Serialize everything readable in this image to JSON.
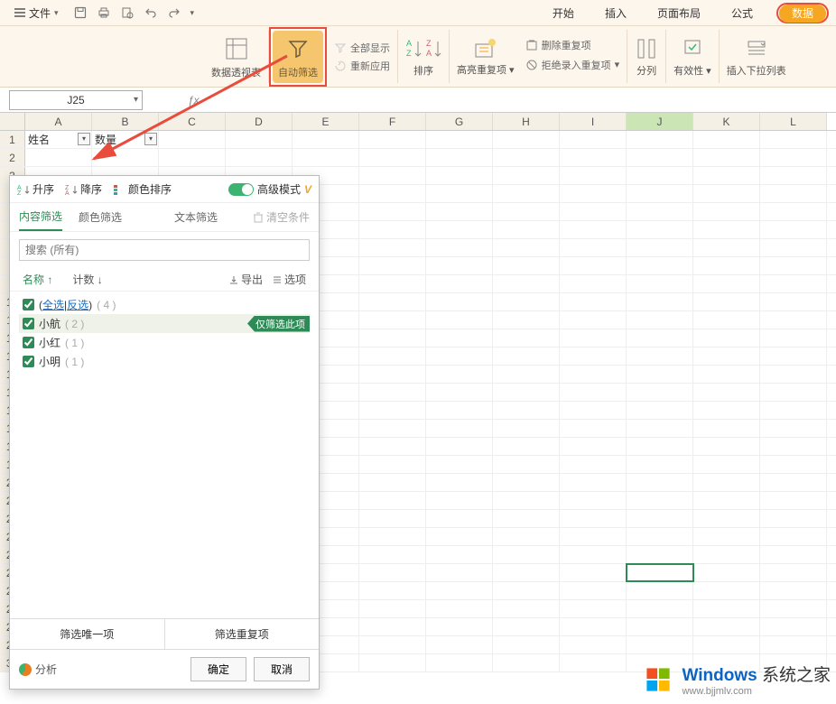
{
  "menubar": {
    "file": "文件",
    "tabs": [
      "开始",
      "插入",
      "页面布局",
      "公式",
      "数据"
    ]
  },
  "ribbon": {
    "pivot": "数据透视表",
    "autofilter": "自动筛选",
    "showall": "全部显示",
    "reapply": "重新应用",
    "sort": "排序",
    "dedup_highlight": "高亮重复项",
    "dedup_delete": "删除重复项",
    "reject_dup": "拒绝录入重复项",
    "split": "分列",
    "validity": "有效性",
    "dropdown": "插入下拉列表"
  },
  "namebox": "J25",
  "headers": {
    "row1": {
      "A": "姓名",
      "B": "数量"
    }
  },
  "columns": [
    "A",
    "B",
    "C",
    "D",
    "E",
    "F",
    "G",
    "H",
    "I",
    "J",
    "K",
    "L"
  ],
  "filter": {
    "asc": "升序",
    "desc": "降序",
    "color_sort": "颜色排序",
    "advanced": "高级模式",
    "tabs": {
      "content": "内容筛选",
      "color": "颜色筛选",
      "text": "文本筛选",
      "clear": "清空条件"
    },
    "search_placeholder": "搜索 (所有)",
    "col_name": "名称",
    "col_count": "计数",
    "export": "导出",
    "options": "选项",
    "select_all": "全选",
    "invert": "反选",
    "total_count": "(  4  )",
    "only_this": "仅筛选此项",
    "items": [
      {
        "label": "小航",
        "count": "(  2  )",
        "hl": true
      },
      {
        "label": "小红",
        "count": "(  1  )",
        "hl": false
      },
      {
        "label": "小明",
        "count": "(  1  )",
        "hl": false
      }
    ],
    "unique": "筛选唯一项",
    "dup": "筛选重复项",
    "analyze": "分析",
    "ok": "确定",
    "cancel": "取消"
  },
  "watermark": {
    "brand": "Windows",
    "suffix": "系统之家",
    "url": "www.bjjmlv.com"
  }
}
